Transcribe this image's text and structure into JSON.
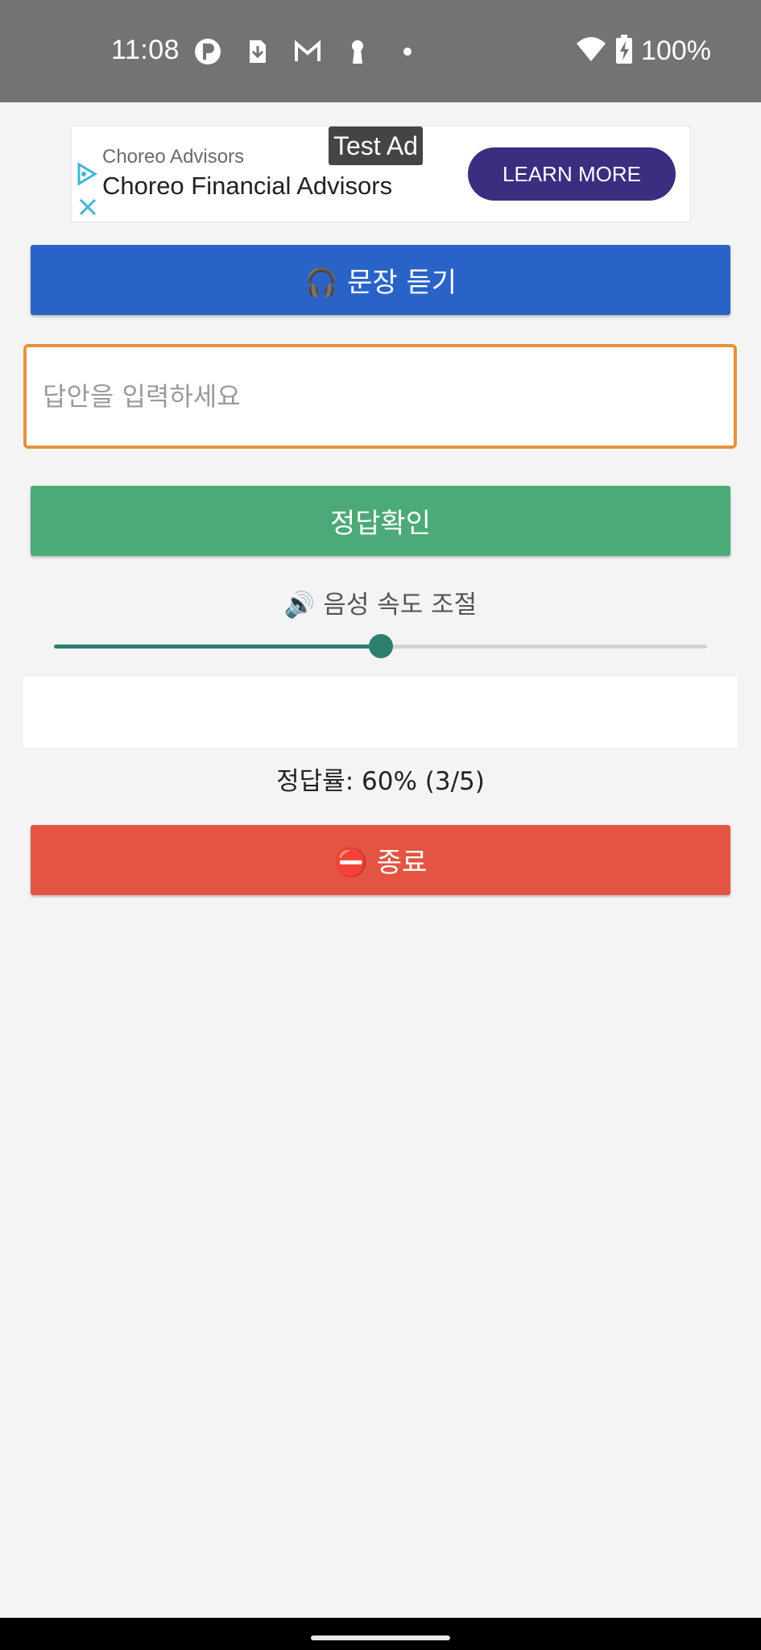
{
  "status_bar": {
    "time": "11:08",
    "battery": "100%",
    "icons_left": [
      "app-icon",
      "download-icon",
      "gmail-icon",
      "keyhole-icon",
      "dot-icon"
    ],
    "icons_right": [
      "wifi-icon",
      "battery-charging-icon"
    ]
  },
  "ad": {
    "test_tag": "Test Ad",
    "advertiser": "Choreo Advisors",
    "headline": "Choreo Financial Advisors",
    "cta": "LEARN MORE"
  },
  "listen_button": {
    "icon": "headphones-icon",
    "label": "🎧 문장 듣기"
  },
  "answer_input": {
    "value": "",
    "placeholder": "답안을 입력하세요"
  },
  "check_button": {
    "label": "정답확인"
  },
  "speed": {
    "icon": "speaker-icon",
    "label": "🔊 음성 속도 조절",
    "value_fraction": 0.5
  },
  "result": {
    "text": ""
  },
  "accuracy": {
    "text": "정답률: 60% (3/5)"
  },
  "exit_button": {
    "icon": "no-entry-icon",
    "label": "⛔ 종료"
  },
  "colors": {
    "listen": "#2a63c8",
    "check": "#4baa77",
    "exit": "#e35443",
    "input_border": "#e8913c",
    "slider": "#2f7f6e",
    "ad_cta": "#3c2d80"
  }
}
